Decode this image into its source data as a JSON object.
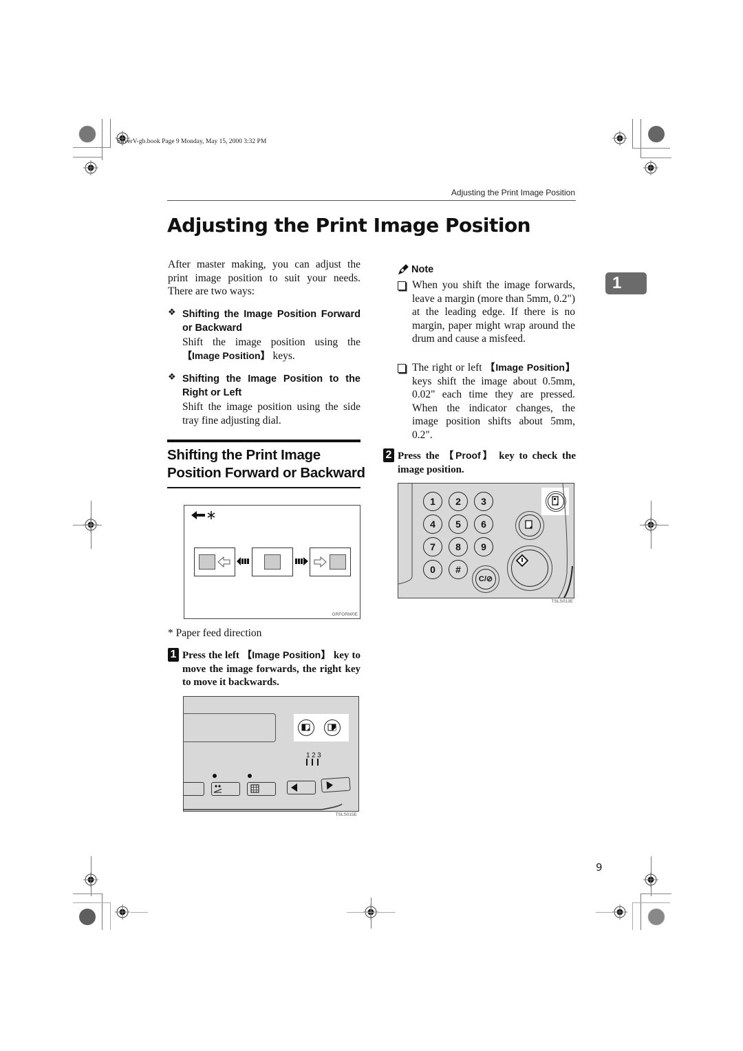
{
  "header": {
    "book_info": "SilverV-gb.book  Page 9  Monday, May 15, 2000  3:32 PM",
    "running_title": "Adjusting the Print Image Position"
  },
  "page_title": "Adjusting the Print Image Position",
  "intro": "After master making, you can adjust the print image position to suit your needs. There are two ways:",
  "ways": [
    {
      "heading": "Shifting the Image Position Forward or Backward",
      "text_before": "Shift the image position using the ",
      "key": "【Image Position】",
      "text_after": " keys."
    },
    {
      "heading": "Shifting the Image Position to the Right or Left",
      "text": "Shift the image position using the side tray fine adjusting dial."
    }
  ],
  "section_heading_line1": "Shifting the Print Image",
  "section_heading_line2": "Position Forward or Backward",
  "figure1": {
    "direction_marker": "← ∗",
    "code": "GRFORW0E",
    "caption": "* Paper feed direction"
  },
  "step1": {
    "number": "1",
    "text_before": "Press the left ",
    "key": "【Image Position】",
    "text_after": " key to move the image forwards, the right key to move it backwards."
  },
  "figure2": {
    "code": "TSLS015E",
    "indicator_labels": [
      "1",
      "2",
      "3"
    ]
  },
  "note": {
    "title": "Note",
    "items": [
      {
        "text": "When you shift the image forwards, leave a margin (more than 5mm, 0.2\") at the leading edge. If there is no margin, paper might wrap around the drum and cause a misfeed."
      },
      {
        "text_before": "The right or left ",
        "key": "【Image Position】",
        "text_after": " keys shift the image about 0.5mm, 0.02\" each time they are pressed. When the indicator changes, the image position shifts about 5mm, 0.2\"."
      }
    ]
  },
  "step2": {
    "number": "2",
    "text_before": "Press the ",
    "key": "【Proof】",
    "text_after": " key to check the image position."
  },
  "figure3": {
    "code": "TSLS013E",
    "keypad": [
      "1",
      "2",
      "3",
      "4",
      "5",
      "6",
      "7",
      "8",
      "9",
      "0",
      "#"
    ],
    "clear_stop_label": "C/⊘"
  },
  "chapter_tab": "1",
  "page_number": "9"
}
